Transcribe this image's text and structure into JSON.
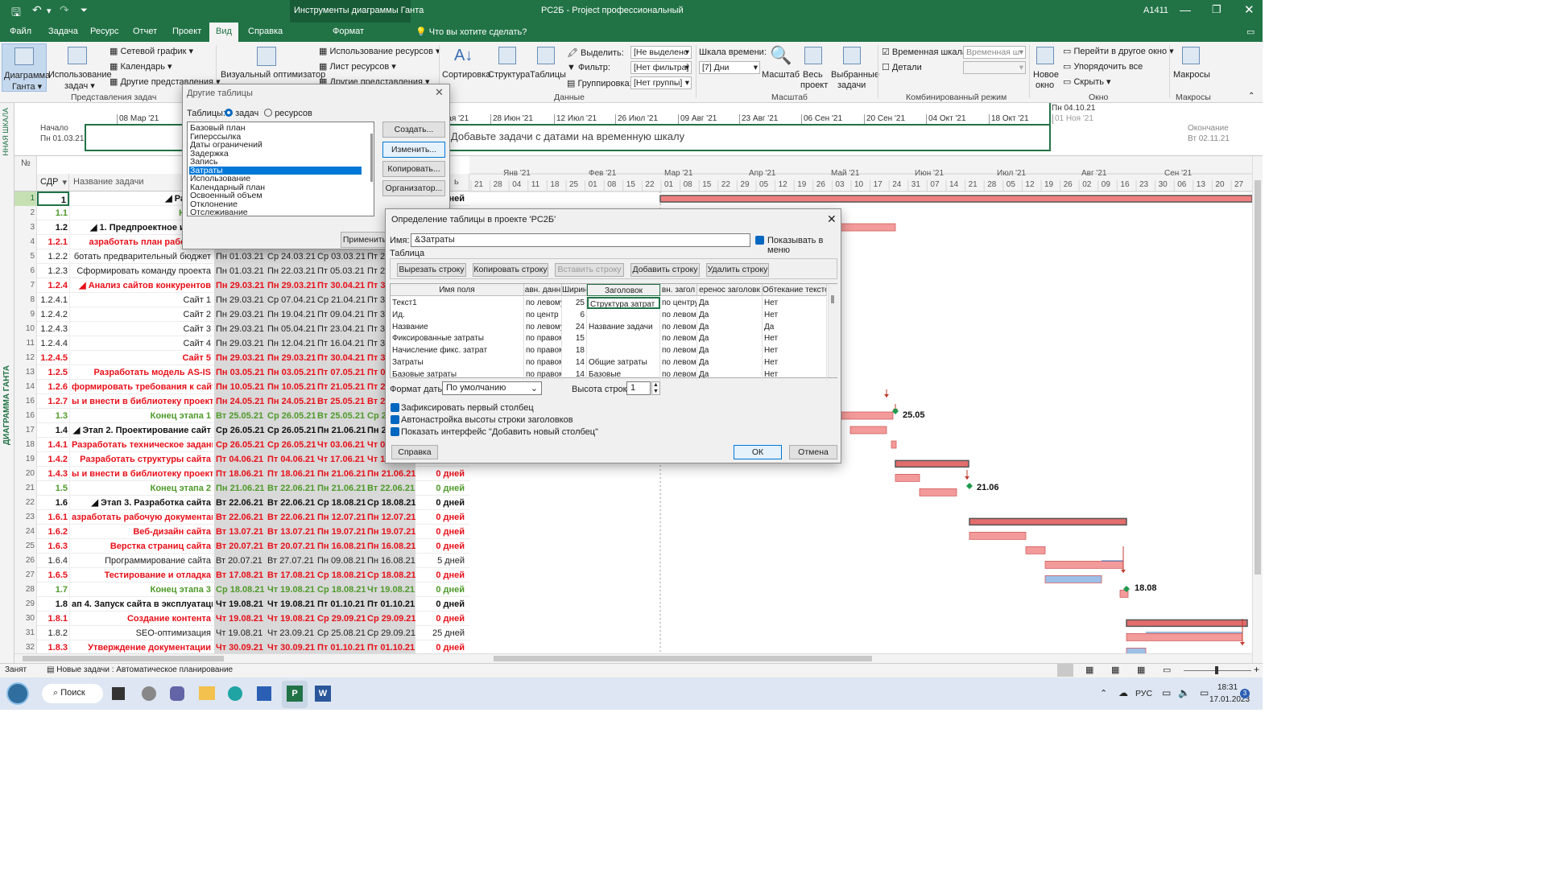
{
  "titlebar": {
    "contextual": "Инструменты диаграммы Ганта",
    "title": "РС2Б  -  Project профессиональный",
    "user": "А1411"
  },
  "tabs": {
    "file": "Файл",
    "task": "Задача",
    "resource": "Ресурс",
    "report": "Отчет",
    "project": "Проект",
    "view": "Вид",
    "help": "Справка",
    "format": "Формат",
    "search": "Что вы хотите сделать?"
  },
  "ribbon": {
    "gantt": "Диаграмма",
    "gantt2": "Ганта ▾",
    "usage": "Использование",
    "usage2": "задач ▾",
    "network": "Сетевой график",
    "calendar": "Календарь",
    "other_views": "Другие представления ▾",
    "task_views": "Представления задач",
    "visual": "Визуальный оптимизатор",
    "res_usage": "Использование ресурсов",
    "res_sheet": "Лист ресурсов",
    "res_other": "Другие представления ▾",
    "sort": "Сортировка",
    "outline": "Структура",
    "tables": "Таблицы",
    "highlight": "Выделить:",
    "filter": "Фильтр:",
    "group": "Группировка:",
    "hl_val": "[Не выделено",
    "flt_val": "[Нет фильтра]",
    "grp_val": "[Нет группы]",
    "data": "Данные",
    "timescale": "Шкала времени:",
    "ts_val": "[7] Дни",
    "zoom": "Масштаб",
    "whole": "Весь",
    "whole2": "проект",
    "selected": "Выбранные",
    "selected2": "задачи",
    "zoom_grp": "Масштаб",
    "timeline_cb": "Временная шкала",
    "timeline_val": "Временная ш",
    "details": "Детали",
    "combo_mode": "Комбинированный режим",
    "new_win": "Новое",
    "new_win2": "окно",
    "switch": "Перейти в другое окно ▾",
    "arrange": "Упорядочить все",
    "hide": "Скрыть ▾",
    "window": "Окно",
    "macros": "Макросы",
    "macros_grp": "Макросы"
  },
  "timeline": {
    "label": "ВРЕМЕННАЯ ШКАЛА",
    "start_lbl": "Начало",
    "start": "Пн 01.03.21",
    "end_lbl": "Окончание",
    "end": "Вт 02.11.21",
    "today": "Пн 04.10.21",
    "placeholder": "Добавьте задачи с датами на временную шкалу",
    "dates": [
      "08 Мар '21",
      "",
      "",
      "",
      "31 Мая '21",
      "28 Июн '21",
      "12 Июл '21",
      "26 Июл '21",
      "09 Авг '21",
      "23 Авг '21",
      "06 Сен '21",
      "20 Сен '21",
      "04 Окт '21",
      "18 Окт '21",
      "01 Ноя '21"
    ]
  },
  "gantt_label": "ДИАГРАММА ГАНТА",
  "grid": {
    "col_num": "№",
    "col_wbs": "СДР",
    "col_name": "Название задачи",
    "col_dur_hdr": "ь",
    "rows": [
      {
        "n": "1",
        "w": "1",
        "name": "◢ Разрабо",
        "d": [
          "",
          "",
          "",
          ""
        ],
        "dur": "дней",
        "s": "blk"
      },
      {
        "n": "2",
        "w": "1.1",
        "name": "Начало",
        "d": [
          "",
          "",
          "",
          ""
        ],
        "dur": "",
        "s": "grn"
      },
      {
        "n": "3",
        "w": "1.2",
        "name": "◢ 1. Предпроектное исслед",
        "d": [
          "",
          "",
          "",
          ""
        ],
        "dur": "",
        "s": "blk"
      },
      {
        "n": "4",
        "w": "1.2.1",
        "name": "азработать план работ по п",
        "d": [
          "",
          "",
          "",
          ""
        ],
        "dur": "",
        "s": "red"
      },
      {
        "n": "5",
        "w": "1.2.2",
        "name": "ботать предварительный бюджет",
        "d": [
          "Пн 01.03.21",
          "Ср 24.03.21",
          "Ср 03.03.21",
          "Пт 2"
        ],
        "dur": "",
        "s": "nrm"
      },
      {
        "n": "6",
        "w": "1.2.3",
        "name": "Сформировать команду проекта",
        "d": [
          "Пн 01.03.21",
          "Пн 22.03.21",
          "Пт 05.03.21",
          "Пт 2"
        ],
        "dur": "",
        "s": "nrm"
      },
      {
        "n": "7",
        "w": "1.2.4",
        "name": "◢ Анализ сайтов конкурентов",
        "d": [
          "Пн 29.03.21",
          "Пн 29.03.21",
          "Пт 30.04.21",
          "Пт 3"
        ],
        "dur": "",
        "s": "red"
      },
      {
        "n": "8",
        "w": "1.2.4.1",
        "name": "Сайт 1",
        "d": [
          "Пн 29.03.21",
          "Ср 07.04.21",
          "Ср 21.04.21",
          "Пт 3"
        ],
        "dur": "",
        "s": "nrm"
      },
      {
        "n": "9",
        "w": "1.2.4.2",
        "name": "Сайт 2",
        "d": [
          "Пн 29.03.21",
          "Пн 19.04.21",
          "Пт 09.04.21",
          "Пт 3"
        ],
        "dur": "",
        "s": "nrm"
      },
      {
        "n": "10",
        "w": "1.2.4.3",
        "name": "Сайт 3",
        "d": [
          "Пн 29.03.21",
          "Пн 05.04.21",
          "Пт 23.04.21",
          "Пт 3"
        ],
        "dur": "",
        "s": "nrm"
      },
      {
        "n": "11",
        "w": "1.2.4.4",
        "name": "Сайт 4",
        "d": [
          "Пн 29.03.21",
          "Пн 12.04.21",
          "Пт 16.04.21",
          "Пт 3"
        ],
        "dur": "",
        "s": "nrm"
      },
      {
        "n": "12",
        "w": "1.2.4.5",
        "name": "Сайт 5",
        "d": [
          "Пн 29.03.21",
          "Пн 29.03.21",
          "Пт 30.04.21",
          "Пт 3"
        ],
        "dur": "",
        "s": "red"
      },
      {
        "n": "13",
        "w": "1.2.5",
        "name": "Разработать модель AS-IS",
        "d": [
          "Пн 03.05.21",
          "Пн 03.05.21",
          "Пт 07.05.21",
          "Пт 0"
        ],
        "dur": "",
        "s": "red"
      },
      {
        "n": "14",
        "w": "1.2.6",
        "name": "формировать требования к сайту",
        "d": [
          "Пн 10.05.21",
          "Пн 10.05.21",
          "Пт 21.05.21",
          "Пт 2"
        ],
        "dur": "",
        "s": "red"
      },
      {
        "n": "16",
        "w": "1.2.7",
        "name": "ы и внести в библиотеку проекта",
        "d": [
          "Пн 24.05.21",
          "Пн 24.05.21",
          "Вт 25.05.21",
          "Вт 2"
        ],
        "dur": "",
        "s": "red"
      },
      {
        "n": "16",
        "w": "1.3",
        "name": "Конец этапа 1",
        "d": [
          "Вт 25.05.21",
          "Ср 26.05.21",
          "Вт 25.05.21",
          "Ср 2"
        ],
        "dur": "",
        "s": "grn"
      },
      {
        "n": "17",
        "w": "1.4",
        "name": "◢ Этап 2. Проектирование сайт",
        "d": [
          "Ср 26.05.21",
          "Ср 26.05.21",
          "Пн 21.06.21",
          "Пн 2"
        ],
        "dur": "",
        "s": "blk"
      },
      {
        "n": "18",
        "w": "1.4.1",
        "name": "Разработать техническое задание",
        "d": [
          "Ср 26.05.21",
          "Ср 26.05.21",
          "Чт 03.06.21",
          "Чт 0"
        ],
        "dur": "",
        "s": "red"
      },
      {
        "n": "19",
        "w": "1.4.2",
        "name": "Разработать структуры сайта",
        "d": [
          "Пт 04.06.21",
          "Пт 04.06.21",
          "Чт 17.06.21",
          "Чт 1"
        ],
        "dur": "",
        "s": "red"
      },
      {
        "n": "20",
        "w": "1.4.3",
        "name": "ы и внести в библиотеку проекта",
        "d": [
          "Пт 18.06.21",
          "Пт 18.06.21",
          "Пн 21.06.21",
          "Пн 21.06.21"
        ],
        "dur": "0 дней",
        "s": "red"
      },
      {
        "n": "21",
        "w": "1.5",
        "name": "Конец этапа 2",
        "d": [
          "Пн 21.06.21",
          "Вт 22.06.21",
          "Пн 21.06.21",
          "Вт 22.06.21"
        ],
        "dur": "0 дней",
        "s": "grn"
      },
      {
        "n": "22",
        "w": "1.6",
        "name": "◢ Этап 3. Разработка сайта",
        "d": [
          "Вт 22.06.21",
          "Вт 22.06.21",
          "Ср 18.08.21",
          "Ср 18.08.21"
        ],
        "dur": "0 дней",
        "s": "blk"
      },
      {
        "n": "23",
        "w": "1.6.1",
        "name": "азработать рабочую документацию",
        "d": [
          "Вт 22.06.21",
          "Вт 22.06.21",
          "Пн 12.07.21",
          "Пн 12.07.21"
        ],
        "dur": "0 дней",
        "s": "red"
      },
      {
        "n": "24",
        "w": "1.6.2",
        "name": "Веб-дизайн сайта",
        "d": [
          "Вт 13.07.21",
          "Вт 13.07.21",
          "Пн 19.07.21",
          "Пн 19.07.21"
        ],
        "dur": "0 дней",
        "s": "red"
      },
      {
        "n": "25",
        "w": "1.6.3",
        "name": "Верстка страниц сайта",
        "d": [
          "Вт 20.07.21",
          "Вт 20.07.21",
          "Пн 16.08.21",
          "Пн 16.08.21"
        ],
        "dur": "0 дней",
        "s": "red"
      },
      {
        "n": "26",
        "w": "1.6.4",
        "name": "Программирование сайта",
        "d": [
          "Вт 20.07.21",
          "Вт 27.07.21",
          "Пн 09.08.21",
          "Пн 16.08.21"
        ],
        "dur": "5 дней",
        "s": "nrm"
      },
      {
        "n": "27",
        "w": "1.6.5",
        "name": "Тестирование и отладка",
        "d": [
          "Вт 17.08.21",
          "Вт 17.08.21",
          "Ср 18.08.21",
          "Ср 18.08.21"
        ],
        "dur": "0 дней",
        "s": "red"
      },
      {
        "n": "28",
        "w": "1.7",
        "name": "Конец этапа 3",
        "d": [
          "Ср 18.08.21",
          "Чт 19.08.21",
          "Ср 18.08.21",
          "Чт 19.08.21"
        ],
        "dur": "0 дней",
        "s": "grn"
      },
      {
        "n": "29",
        "w": "1.8",
        "name": "ап 4. Запуск сайта в эксплуатацию",
        "d": [
          "Чт 19.08.21",
          "Чт 19.08.21",
          "Пт 01.10.21",
          "Пт 01.10.21"
        ],
        "dur": "0 дней",
        "s": "blk"
      },
      {
        "n": "30",
        "w": "1.8.1",
        "name": "Создание контента",
        "d": [
          "Чт 19.08.21",
          "Чт 19.08.21",
          "Ср 29.09.21",
          "Ср 29.09.21"
        ],
        "dur": "0 дней",
        "s": "red"
      },
      {
        "n": "31",
        "w": "1.8.2",
        "name": "SEO-оптимизация",
        "d": [
          "Чт 19.08.21",
          "Чт 23.09.21",
          "Ср 25.08.21",
          "Ср 29.09.21"
        ],
        "dur": "25 дней",
        "s": "nrm"
      },
      {
        "n": "32",
        "w": "1.8.3",
        "name": "Утверждение документации",
        "d": [
          "Чт 30.09.21",
          "Чт 30.09.21",
          "Пт 01.10.21",
          "Пт 01.10.21"
        ],
        "dur": "0 дней",
        "s": "red"
      }
    ]
  },
  "chart": {
    "months": [
      "Янв '21",
      "Фев '21",
      "Мар '21",
      "Апр '21",
      "Май '21",
      "Июн '21",
      "Июл '21",
      "Авг '21",
      "Сен '21"
    ],
    "days": [
      "21",
      "28",
      "04",
      "11",
      "18",
      "25",
      "01",
      "08",
      "15",
      "22",
      "01",
      "08",
      "15",
      "22",
      "29",
      "05",
      "12",
      "19",
      "26",
      "03",
      "10",
      "17",
      "24",
      "31",
      "07",
      "14",
      "21",
      "28",
      "05",
      "12",
      "19",
      "26",
      "02",
      "09",
      "16",
      "23",
      "30",
      "06",
      "13",
      "20",
      "27"
    ],
    "labels": [
      "25.05",
      "21.06",
      "18.08"
    ]
  },
  "dlg_other": {
    "title": "Другие таблицы",
    "tables_lbl": "Таблицы:",
    "task_radio": "задач",
    "res_radio": "ресурсов",
    "items": [
      "Базовый план",
      "Гиперссылка",
      "Даты ограничений",
      "Задержка",
      "Запись",
      "Затраты",
      "Использование",
      "Календарный план",
      "Освоенный объем",
      "Отклонение",
      "Отслеживание"
    ],
    "selected_index": 5,
    "new": "Создать...",
    "edit": "Изменить...",
    "copy": "Копировать...",
    "organizer": "Организатор...",
    "apply": "Применить"
  },
  "dlg_def": {
    "title": "Определение таблицы в проекте 'РС2Б'",
    "name_lbl": "Имя:",
    "name_val": "&Затраты",
    "show_menu": "Показывать в меню",
    "table_lbl": "Таблица",
    "cut": "Вырезать строку",
    "copy": "Копировать строку",
    "paste": "Вставить строку",
    "add": "Добавить строку",
    "delete": "Удалить строку",
    "cols": [
      "Имя поля",
      "авн. данн",
      "Ширин",
      "Заголовок",
      "вн. загол",
      "еренос заголовк",
      "Обтекание текстом"
    ],
    "rows": [
      [
        "Текст1",
        "по левому",
        "25",
        "Структура затрат",
        "по центру",
        "Да",
        "Нет"
      ],
      [
        "Ид.",
        "по центр",
        "6",
        "",
        "по левому",
        "Да",
        "Нет"
      ],
      [
        "Название",
        "по левому",
        "24",
        "Название задачи",
        "по левому",
        "Да",
        "Да"
      ],
      [
        "Фиксированные затраты",
        "по правом",
        "15",
        "",
        "по левому",
        "Да",
        "Нет"
      ],
      [
        "Начисление фикс. затрат",
        "по правом",
        "18",
        "",
        "по левому",
        "Да",
        "Нет"
      ],
      [
        "Затраты",
        "по правом",
        "14",
        "Общие затраты",
        "по левому",
        "Да",
        "Нет"
      ],
      [
        "Базовые затраты",
        "по правом",
        "14",
        "Базовые",
        "по левому",
        "Да",
        "Нет"
      ]
    ],
    "date_fmt_lbl": "Формат даты:",
    "date_fmt_val": "По умолчанию",
    "row_h_lbl": "Высота строк:",
    "row_h_val": "1",
    "cb1": "Зафиксировать первый столбец",
    "cb2": "Автонастройка высоты строки заголовков",
    "cb3": "Показать интерфейс \"Добавить новый столбец\"",
    "help": "Справка",
    "ok": "ОК",
    "cancel": "Отмена"
  },
  "status": {
    "ready": "Занят",
    "mode": "Новые задачи : Автоматическое планирование"
  },
  "taskbar": {
    "search": "Поиск",
    "lang": "РУС",
    "time": "18:31",
    "date": "17.01.2023",
    "badge": "3"
  },
  "colors": {
    "green": "#217346",
    "bar_red": "#f08080",
    "bar_blue": "#8fb4e3",
    "milestone": "#1f9a4b"
  }
}
